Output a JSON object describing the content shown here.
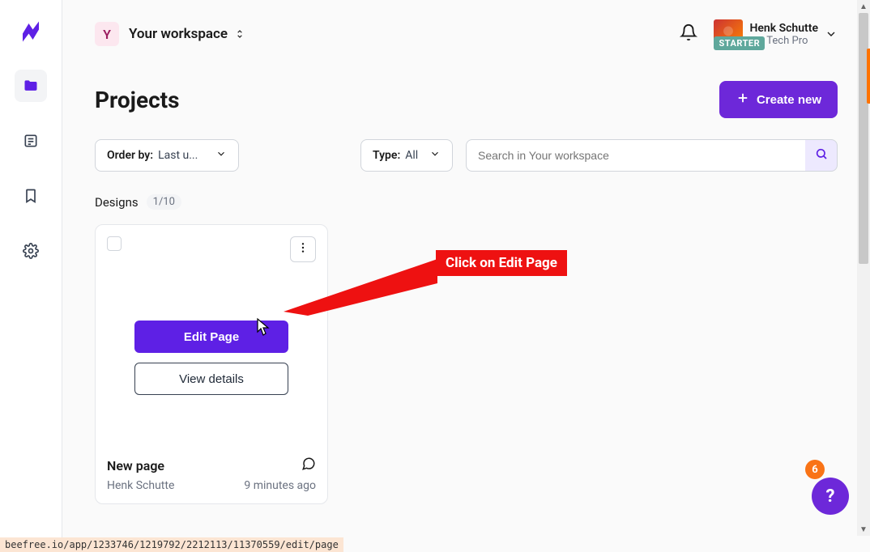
{
  "workspace": {
    "initial": "Y",
    "name": "Your workspace"
  },
  "user": {
    "name": "Henk Schutte",
    "subtitle": "est Tech Pro",
    "badge": "STARTER"
  },
  "page": {
    "title": "Projects",
    "create_label": "Create new"
  },
  "filters": {
    "order_label": "Order by:",
    "order_value": "Last u...",
    "type_label": "Type:",
    "type_value": "All",
    "search_placeholder": "Search in Your workspace"
  },
  "designs": {
    "label": "Designs",
    "count": "1/10"
  },
  "card": {
    "edit_label": "Edit Page",
    "view_label": "View details",
    "title": "New page",
    "author": "Henk Schutte",
    "time": "9 minutes ago"
  },
  "annotation": {
    "text": "Click on Edit Page"
  },
  "help": {
    "badge": "6",
    "symbol": "?"
  },
  "statusbar": {
    "text": "beefree.io/app/1233746/1219792/2212113/11370559/edit/page"
  }
}
